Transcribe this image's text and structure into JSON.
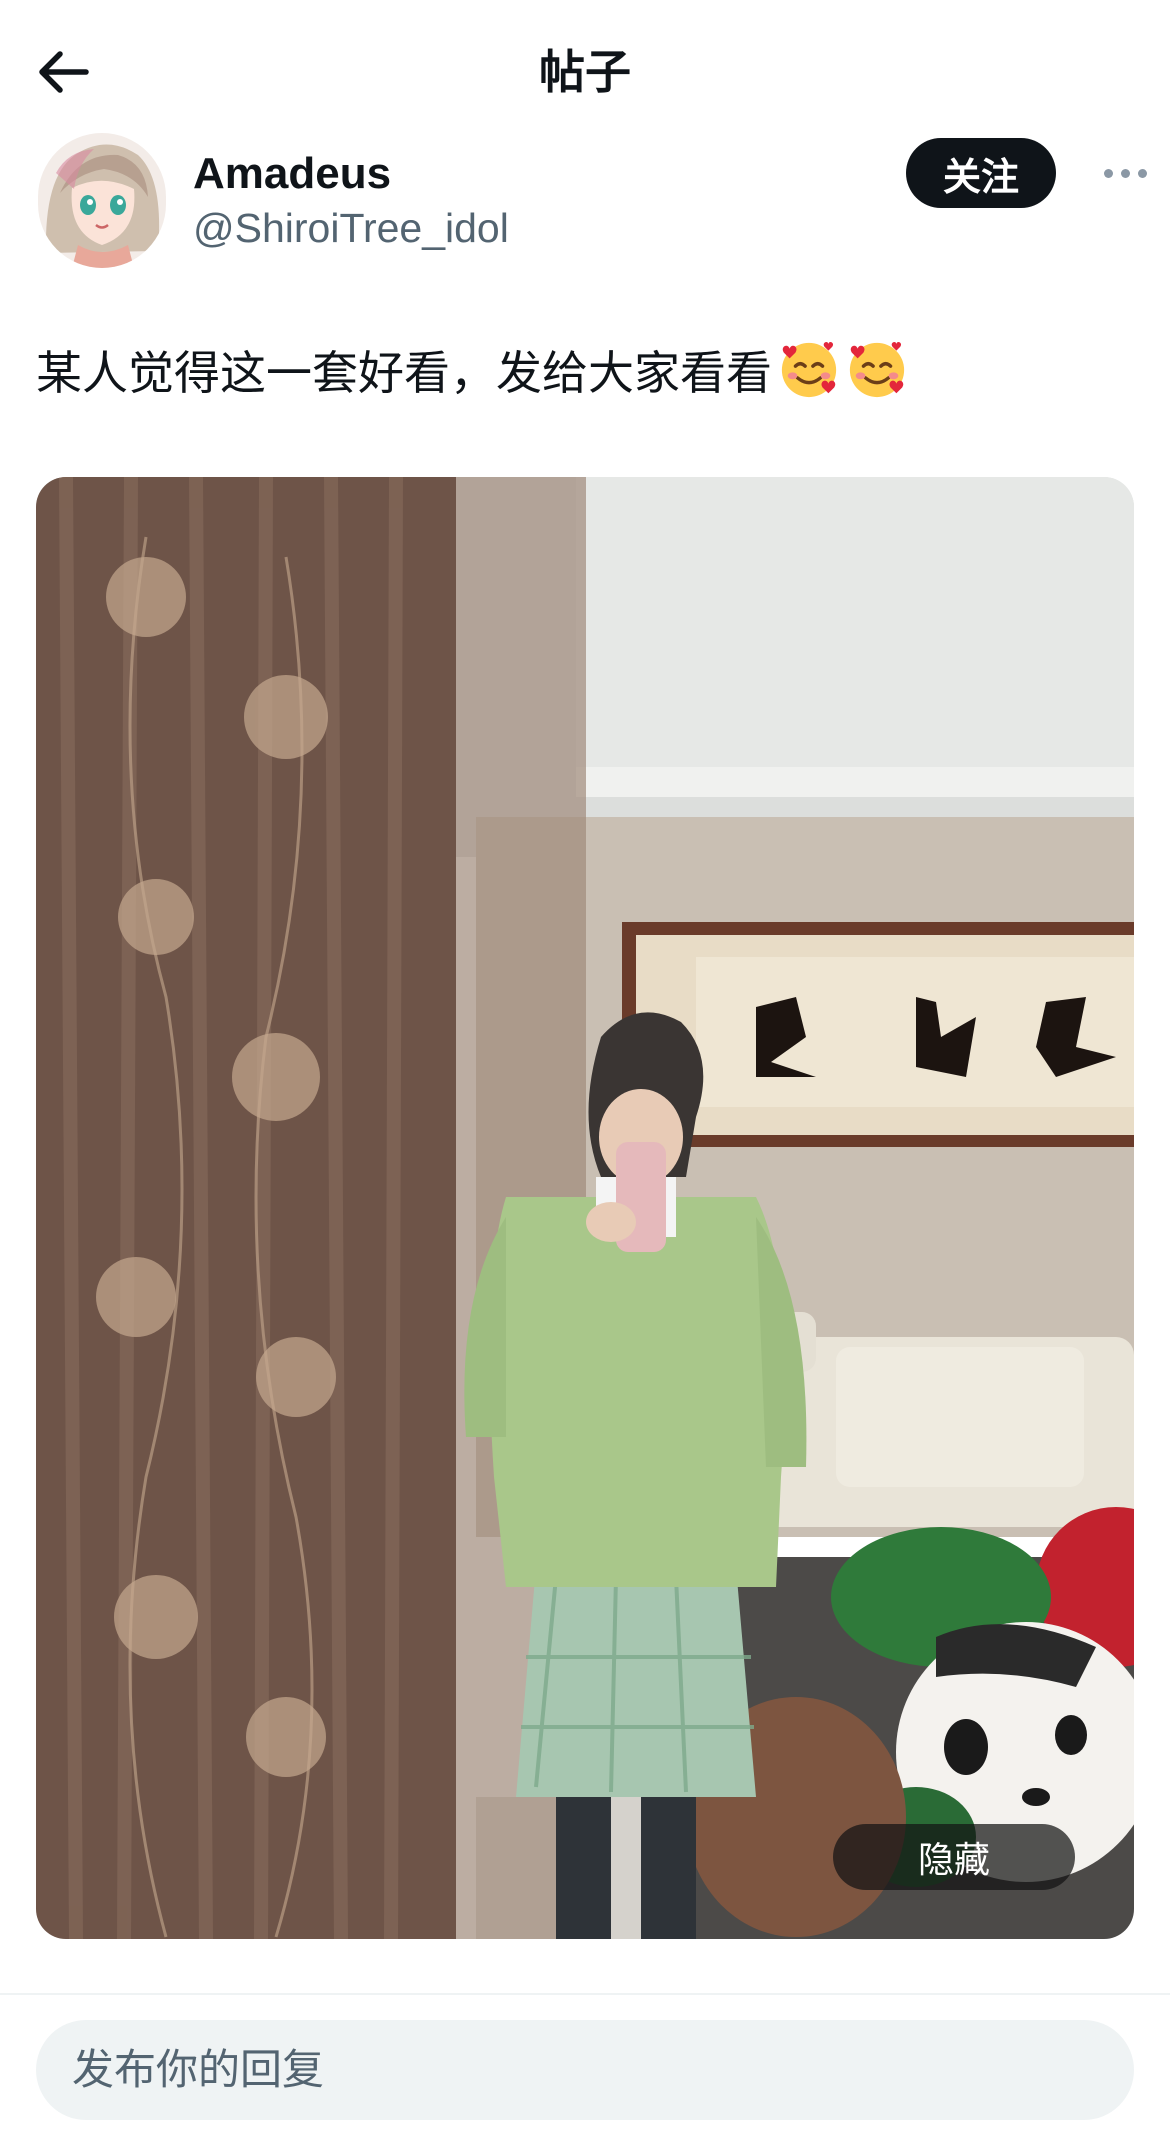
{
  "header": {
    "title": "帖子",
    "back_icon": "arrow-left-icon"
  },
  "author": {
    "display_name": "Amadeus",
    "handle": "@ShiroiTree_idol",
    "avatar_icon": "anime-girl-avatar",
    "follow_label": "关注",
    "more_icon": "more-horizontal-icon"
  },
  "post": {
    "text": "某人觉得这一套好看，发给大家看看",
    "emojis": [
      "smiling-face-with-hearts",
      "smiling-face-with-hearts"
    ],
    "media_hide_label": "隐藏"
  },
  "composer": {
    "placeholder": "发布你的回复"
  },
  "colors": {
    "text": "#0f1419",
    "secondary": "#536471",
    "follow_bg": "#0f1419",
    "reply_bg": "#eff3f4"
  }
}
